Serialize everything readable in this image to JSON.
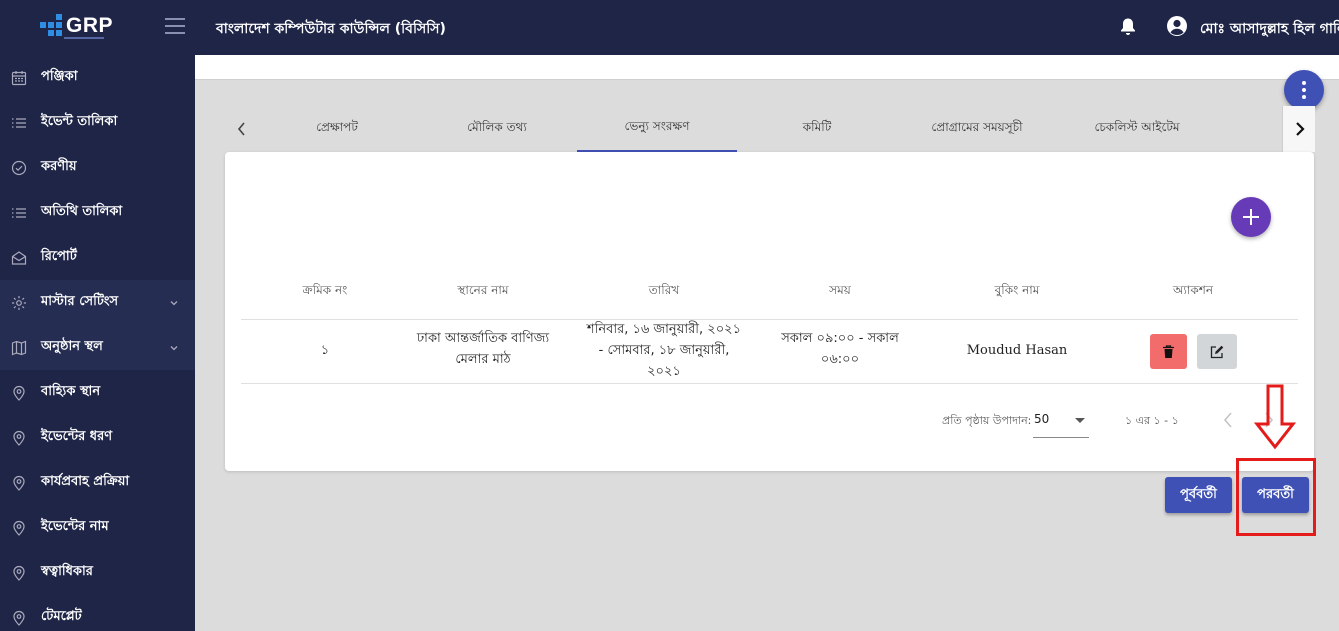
{
  "header": {
    "logo_text": "GRP",
    "app_title": "বাংলাদেশ কম্পিউটার কাউন্সিল (বিসিসি)",
    "user_name": "মোঃ আসাদুল্লাহ হিল গালিব"
  },
  "sidebar": {
    "items": [
      {
        "label": "পঞ্জিকা",
        "icon": "calendar-icon"
      },
      {
        "label": "ইভেন্ট তালিকা",
        "icon": "list-icon"
      },
      {
        "label": "করণীয়",
        "icon": "check-circle-icon"
      },
      {
        "label": "অতিথি তালিকা",
        "icon": "list-icon"
      },
      {
        "label": "রিপোর্ট",
        "icon": "mail-icon"
      },
      {
        "label": "মাস্টার সেটিংস",
        "icon": "gear-icon"
      },
      {
        "label": "অনুষ্ঠান স্থল",
        "icon": "map-icon"
      },
      {
        "label": "বাহ্যিক স্থান",
        "icon": "location-pin-icon"
      },
      {
        "label": "ইভেন্টের ধরণ",
        "icon": "location-pin-icon"
      },
      {
        "label": "কার্যপ্রবাহ প্রক্রিয়া",
        "icon": "location-pin-icon"
      },
      {
        "label": "ইভেন্টের নাম",
        "icon": "location-pin-icon"
      },
      {
        "label": "স্বত্বাধিকার",
        "icon": "location-pin-icon"
      },
      {
        "label": "টেমপ্লেট",
        "icon": "location-pin-icon"
      }
    ]
  },
  "tabs": [
    {
      "label": "প্রেক্ষাপট"
    },
    {
      "label": "মৌলিক তথ্য"
    },
    {
      "label": "ভেন্যু সংরক্ষণ"
    },
    {
      "label": "কমিটি"
    },
    {
      "label": "প্রোগ্রামের সময়সূচী"
    },
    {
      "label": "চেকলিস্ট আইটেম"
    }
  ],
  "table": {
    "headers": [
      "ক্রমিক নং",
      "স্থানের নাম",
      "তারিখ",
      "সময়",
      "বুকিং নাম",
      "অ্যাকশন"
    ],
    "rows": [
      {
        "serial": "১",
        "place_line1": "ঢাকা আন্তর্জাতিক বাণিজ্য",
        "place_line2": "মেলার মাঠ",
        "date_line1": "শনিবার, ১৬ জানুয়ারী, ২০২১",
        "date_line2": "- সোমবার, ১৮ জানুয়ারী,",
        "date_line3": "২০২১",
        "time_line1": "সকাল ০৯:০০ - সকাল",
        "time_line2": "০৬:০০",
        "booking_name": "Moudud Hasan"
      }
    ]
  },
  "pagination": {
    "per_page_label": "প্রতি পৃষ্ঠায় উপাদান:",
    "per_page_value": "50",
    "range_text": "১ এর ১ - ১"
  },
  "buttons": {
    "previous": "পূর্ববর্তী",
    "next": "পরবর্তী"
  },
  "colors": {
    "nav_bg": "#1f2547",
    "primary": "#3f51b5",
    "add_fab": "#673ab7",
    "delete": "#f26c6c",
    "highlight": "#e31b1b"
  }
}
